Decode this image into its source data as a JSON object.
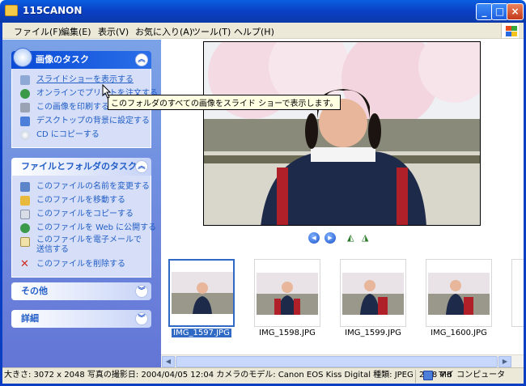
{
  "window": {
    "title": "115CANON"
  },
  "menu": [
    "ファイル(F)",
    "編集(E)",
    "表示(V)",
    "お気に入り(A)",
    "ツール(T)",
    "ヘルプ(H)"
  ],
  "panels": {
    "image_tasks": {
      "title": "画像のタスク",
      "items": [
        {
          "label": "スライドショーを表示する",
          "icon": "slideshow-icon"
        },
        {
          "label": "オンラインでプリントを注文する",
          "icon": "online-print-icon"
        },
        {
          "label": "この画像を印刷する",
          "icon": "printer-icon"
        },
        {
          "label": "デスクトップの背景に設定する",
          "icon": "desktop-icon"
        },
        {
          "label": "CD にコピーする",
          "icon": "cd-icon"
        }
      ]
    },
    "file_tasks": {
      "title": "ファイルとフォルダのタスク",
      "items": [
        {
          "label": "このファイルの名前を変更する",
          "icon": "rename-icon"
        },
        {
          "label": "このファイルを移動する",
          "icon": "move-icon"
        },
        {
          "label": "このファイルをコピーする",
          "icon": "copy-icon"
        },
        {
          "label": "このファイルを Web に公開する",
          "icon": "web-publish-icon"
        },
        {
          "label": "このファイルを電子メールで送信する",
          "icon": "email-icon"
        },
        {
          "label": "このファイルを削除する",
          "icon": "delete-icon"
        }
      ]
    },
    "other": {
      "title": "その他"
    },
    "details": {
      "title": "詳細"
    }
  },
  "tooltip": "このフォルダのすべての画像をスライド ショーで表示します。",
  "thumbnails": [
    {
      "label": "IMG_1597.JPG",
      "selected": true
    },
    {
      "label": "IMG_1598.JPG",
      "selected": false
    },
    {
      "label": "IMG_1599.JPG",
      "selected": false
    },
    {
      "label": "IMG_1600.JPG",
      "selected": false
    }
  ],
  "status": {
    "text": "大きさ: 3072 x 2048 写真の撮影日: 2004/04/05 12:04 カメラのモデル: Canon EOS Kiss Digital 種類: JPEG",
    "size": "2.28 MB",
    "zone": "マイ コンピュータ"
  },
  "colors": {
    "titlebar": "#0a4bd6",
    "selection": "#316ac5",
    "link": "#215dc6",
    "tooltip_bg": "#ffffe1"
  }
}
